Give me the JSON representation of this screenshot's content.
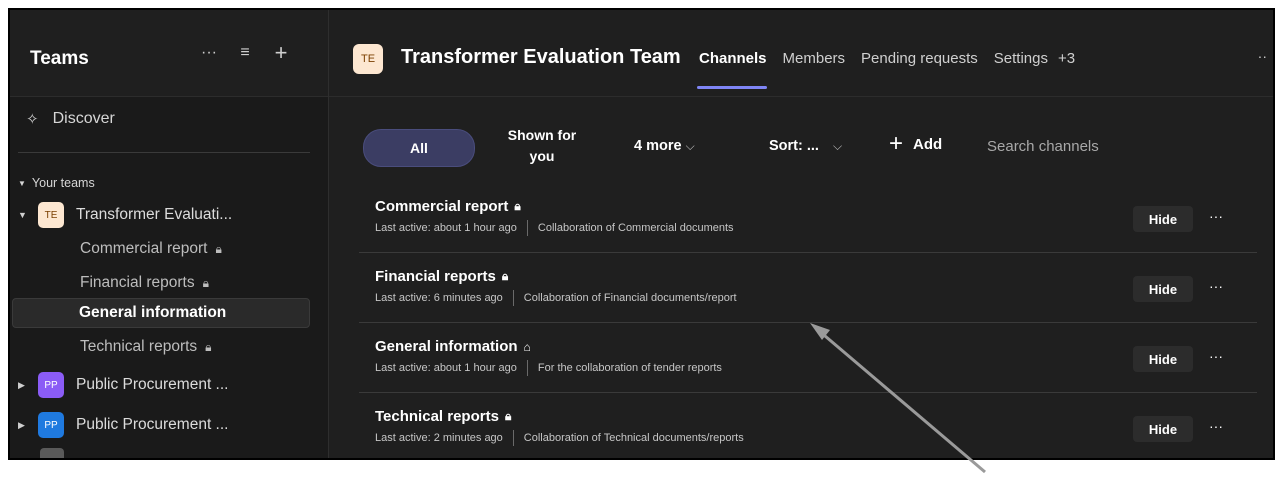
{
  "sidebar": {
    "title": "Teams",
    "actions": {
      "more": "···",
      "filter": "≡",
      "add": "+"
    },
    "discover": "Discover",
    "your_teams": "Your teams",
    "teams": [
      {
        "avatar": "TE",
        "name": "Transformer Evaluati...",
        "avatar_bg": "#fde7d1",
        "avatar_fg": "#7a3f00"
      },
      {
        "avatar": "PP",
        "name": "Public Procurement ...",
        "avatar_bg": "#8b5cf6",
        "avatar_fg": "#ffffff"
      },
      {
        "avatar": "PP",
        "name": "Public Procurement ...",
        "avatar_bg": "#1f7ae0",
        "avatar_fg": "#ffffff"
      }
    ],
    "channels": [
      {
        "label": "Commercial report"
      },
      {
        "label": "Financial reports"
      },
      {
        "label": "General information"
      },
      {
        "label": "Technical reports"
      }
    ]
  },
  "header": {
    "avatar": "TE",
    "team_title": "Transformer Evaluation Team",
    "tabs": [
      "Channels",
      "Members",
      "Pending requests",
      "Settings",
      "+3"
    ],
    "more": "··"
  },
  "filters": {
    "all": "All",
    "shown_for_line1": "Shown for",
    "shown_for_line2": "you",
    "more": "4 more",
    "sort": "Sort: ...",
    "add": "Add",
    "search_placeholder": "Search channels"
  },
  "channel_rows": [
    {
      "title": "Commercial report",
      "last_active": "Last active: about 1 hour ago",
      "description": "Collaboration of Commercial documents",
      "hide": "Hide"
    },
    {
      "title": "Financial reports",
      "last_active": "Last active: 6 minutes ago",
      "description": "Collaboration of Financial documents/report",
      "hide": "Hide"
    },
    {
      "title": "General information",
      "last_active": "Last active: about 1 hour ago",
      "description": "For the collaboration of tender reports",
      "hide": "Hide"
    },
    {
      "title": "Technical reports",
      "last_active": "Last active: 2 minutes ago",
      "description": "Collaboration of Technical documents/reports",
      "hide": "Hide"
    }
  ],
  "colors": {
    "accent": "#7f85f5",
    "background": "#1f1f1f",
    "sidebar": "#1a1a1a"
  }
}
